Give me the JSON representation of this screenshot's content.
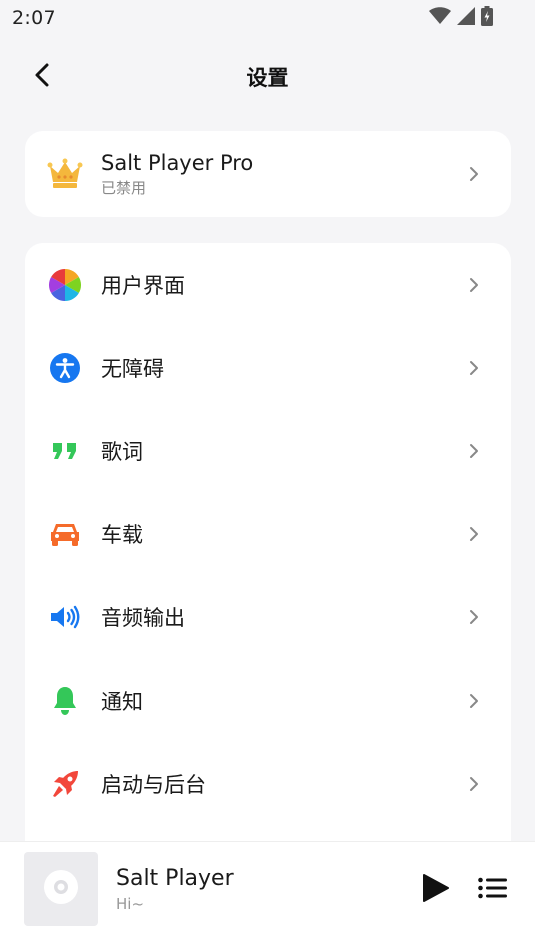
{
  "status_bar": {
    "time": "2:07"
  },
  "header": {
    "title": "设置"
  },
  "pro": {
    "title": "Salt Player Pro",
    "subtitle": "已禁用",
    "icon": "crown-icon"
  },
  "settings_items": [
    {
      "label": "用户界面",
      "icon": "color-wheel-icon"
    },
    {
      "label": "无障碍",
      "icon": "accessibility-icon"
    },
    {
      "label": "歌词",
      "icon": "quote-icon"
    },
    {
      "label": "车载",
      "icon": "car-icon"
    },
    {
      "label": "音频输出",
      "icon": "speaker-icon"
    },
    {
      "label": "通知",
      "icon": "bell-icon"
    },
    {
      "label": "启动与后台",
      "icon": "rocket-icon"
    }
  ],
  "player": {
    "title": "Salt Player",
    "subtitle": "Hi~"
  },
  "colors": {
    "background": "#f5f5f7",
    "card": "#ffffff",
    "accessibility_blue": "#1677f0",
    "lyrics_green": "#34c759",
    "car_orange": "#f56b2a",
    "audio_blue": "#1677f0",
    "bell_green": "#34c759",
    "rocket_red": "#f2473b",
    "crown_gold": "#f4b73c"
  }
}
